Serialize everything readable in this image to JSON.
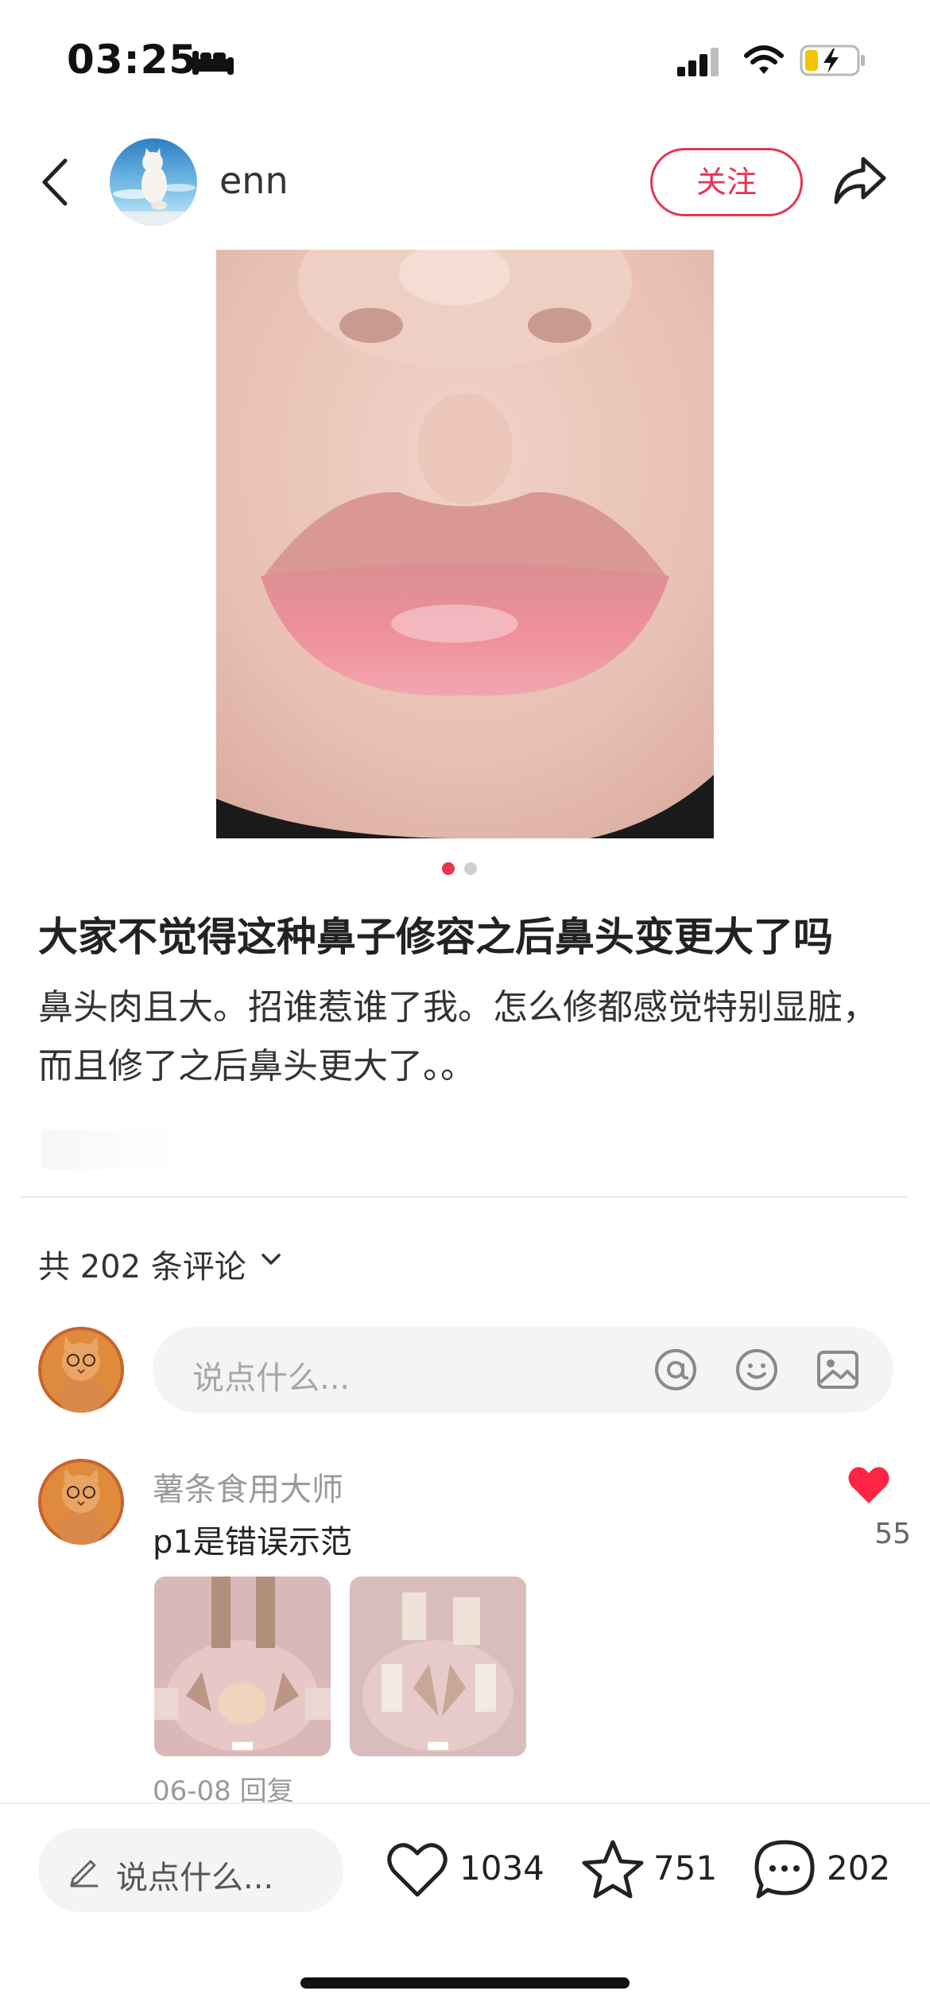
{
  "status_bar": {
    "time": "03:25"
  },
  "author": {
    "name": "enn",
    "follow_label": "关注"
  },
  "post": {
    "title": "大家不觉得这种鼻子修容之后鼻头变更大了吗",
    "body": "鼻头肉且大。招谁惹谁了我。怎么修都感觉特别显脏，而且修了之后鼻头更大了。。",
    "image_count": 2,
    "current_image": 1
  },
  "comments_section": {
    "count_label": "共 202 条评论",
    "input_placeholder": "说点什么..."
  },
  "comment": {
    "author": "薯条食用大师",
    "text": "p1是错误示范",
    "likes": "55",
    "date": "06-08",
    "reply_label": "回复"
  },
  "bottom_bar": {
    "input_placeholder": "说点什么...",
    "like_count": "1034",
    "collect_count": "751",
    "comment_count": "202"
  },
  "colors": {
    "accent": "#e53553",
    "heart": "#ff2442"
  }
}
